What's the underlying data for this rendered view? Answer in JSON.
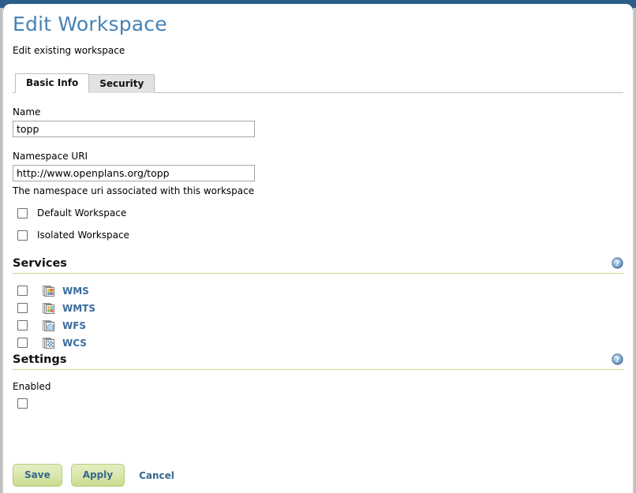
{
  "page": {
    "title": "Edit Workspace",
    "subtitle": "Edit existing workspace"
  },
  "tabs": [
    {
      "label": "Basic Info",
      "active": true
    },
    {
      "label": "Security",
      "active": false
    }
  ],
  "form": {
    "name": {
      "label": "Name",
      "value": "topp",
      "placeholder": ""
    },
    "namespace_uri": {
      "label": "Namespace URI",
      "value": "http://www.openplans.org/topp",
      "placeholder": "",
      "hint": "The namespace uri associated with this workspace"
    },
    "default_workspace": {
      "label": "Default Workspace",
      "checked": false
    },
    "isolated_workspace": {
      "label": "Isolated Workspace",
      "checked": false
    }
  },
  "services": {
    "title": "Services",
    "help_icon": "help-icon",
    "items": [
      {
        "label": "WMS",
        "icon": "wms-service-icon",
        "checked": false
      },
      {
        "label": "WMTS",
        "icon": "wmts-service-icon",
        "checked": false
      },
      {
        "label": "WFS",
        "icon": "wfs-service-icon",
        "checked": false
      },
      {
        "label": "WCS",
        "icon": "wcs-service-icon",
        "checked": false
      }
    ]
  },
  "settings": {
    "title": "Settings",
    "help_icon": "help-icon",
    "enabled": {
      "label": "Enabled",
      "checked": false
    }
  },
  "actions": {
    "save": "Save",
    "apply": "Apply",
    "cancel": "Cancel"
  },
  "colors": {
    "title_blue": "#4682b4",
    "link_blue": "#3b6c9e",
    "button_green": "#c9dc8d",
    "rule_green": "#c3d98b",
    "chrome_blue": "#2b5d88"
  }
}
